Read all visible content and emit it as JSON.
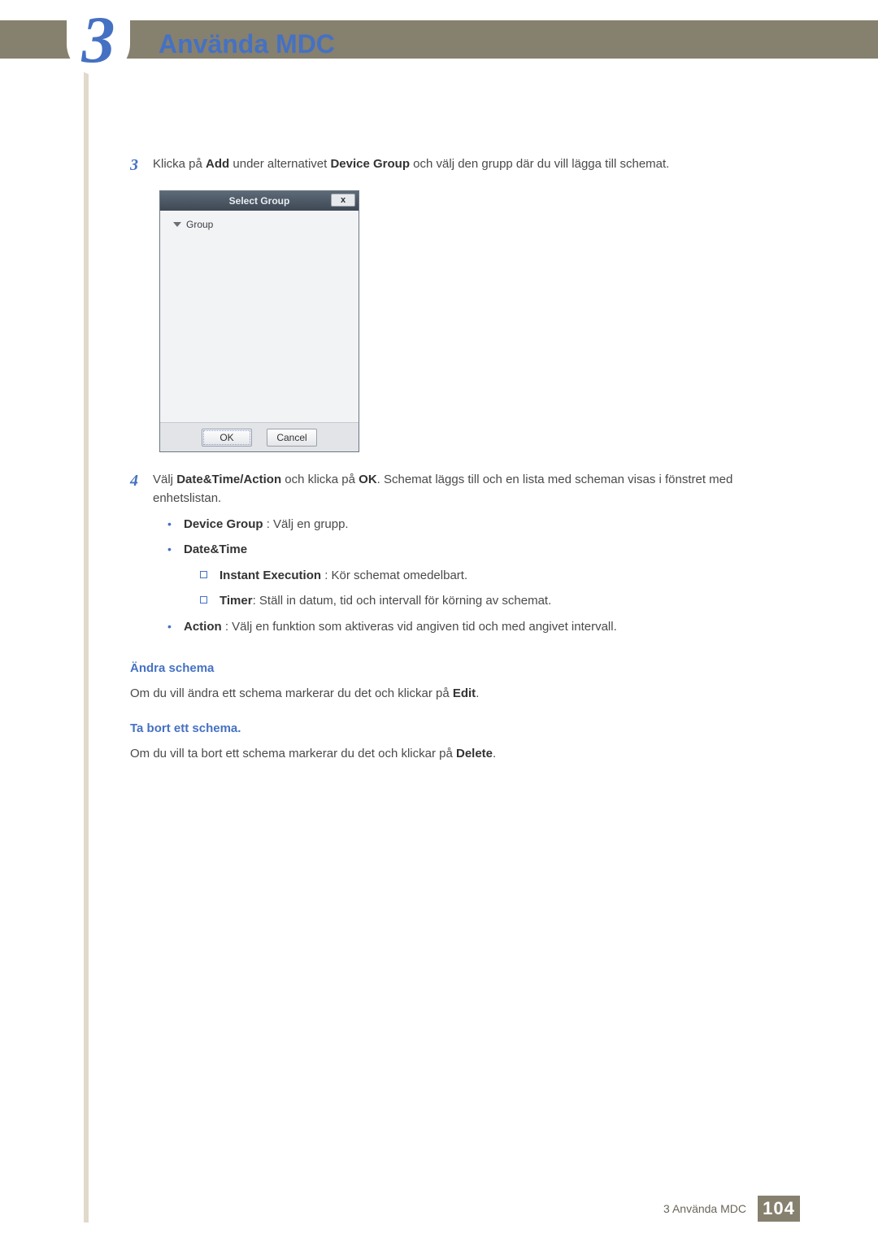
{
  "chapter": {
    "number": "3",
    "title": "Använda MDC"
  },
  "steps": {
    "s3": {
      "num": "3",
      "pre": "Klicka på ",
      "add": "Add",
      "mid": " under alternativet ",
      "dg": "Device Group",
      "post": " och välj den grupp där du vill lägga till schemat."
    },
    "s4": {
      "num": "4",
      "pre": "Välj ",
      "dta": "Date&Time/Action",
      "mid": " och klicka på ",
      "ok": "OK",
      "post": ". Schemat läggs till och en lista med scheman visas i fönstret med enhetslistan."
    }
  },
  "dialog": {
    "title": "Select Group",
    "close": "x",
    "tree_item": "Group",
    "ok": "OK",
    "cancel": "Cancel"
  },
  "bullets": {
    "b1": {
      "bold": "Device Group",
      "text": " : Välj en grupp."
    },
    "b2": {
      "bold": "Date&Time"
    },
    "b2a": {
      "bold": "Instant Execution",
      "text": " : Kör schemat omedelbart."
    },
    "b2b": {
      "bold": "Timer",
      "text": ": Ställ in datum, tid och intervall för körning av schemat."
    },
    "b3": {
      "bold": "Action",
      "text": " : Välj en funktion som aktiveras vid angiven tid och med angivet intervall."
    }
  },
  "sections": {
    "edit_heading": "Ändra schema",
    "edit_para_pre": "Om du vill ändra ett schema markerar du det och klickar på ",
    "edit_bold": "Edit",
    "edit_para_post": ".",
    "delete_heading": "Ta bort ett schema.",
    "delete_para_pre": "Om du vill ta bort ett schema markerar du det och klickar på ",
    "delete_bold": "Delete",
    "delete_para_post": "."
  },
  "footer": {
    "label": "3 Använda MDC",
    "page": "104"
  }
}
